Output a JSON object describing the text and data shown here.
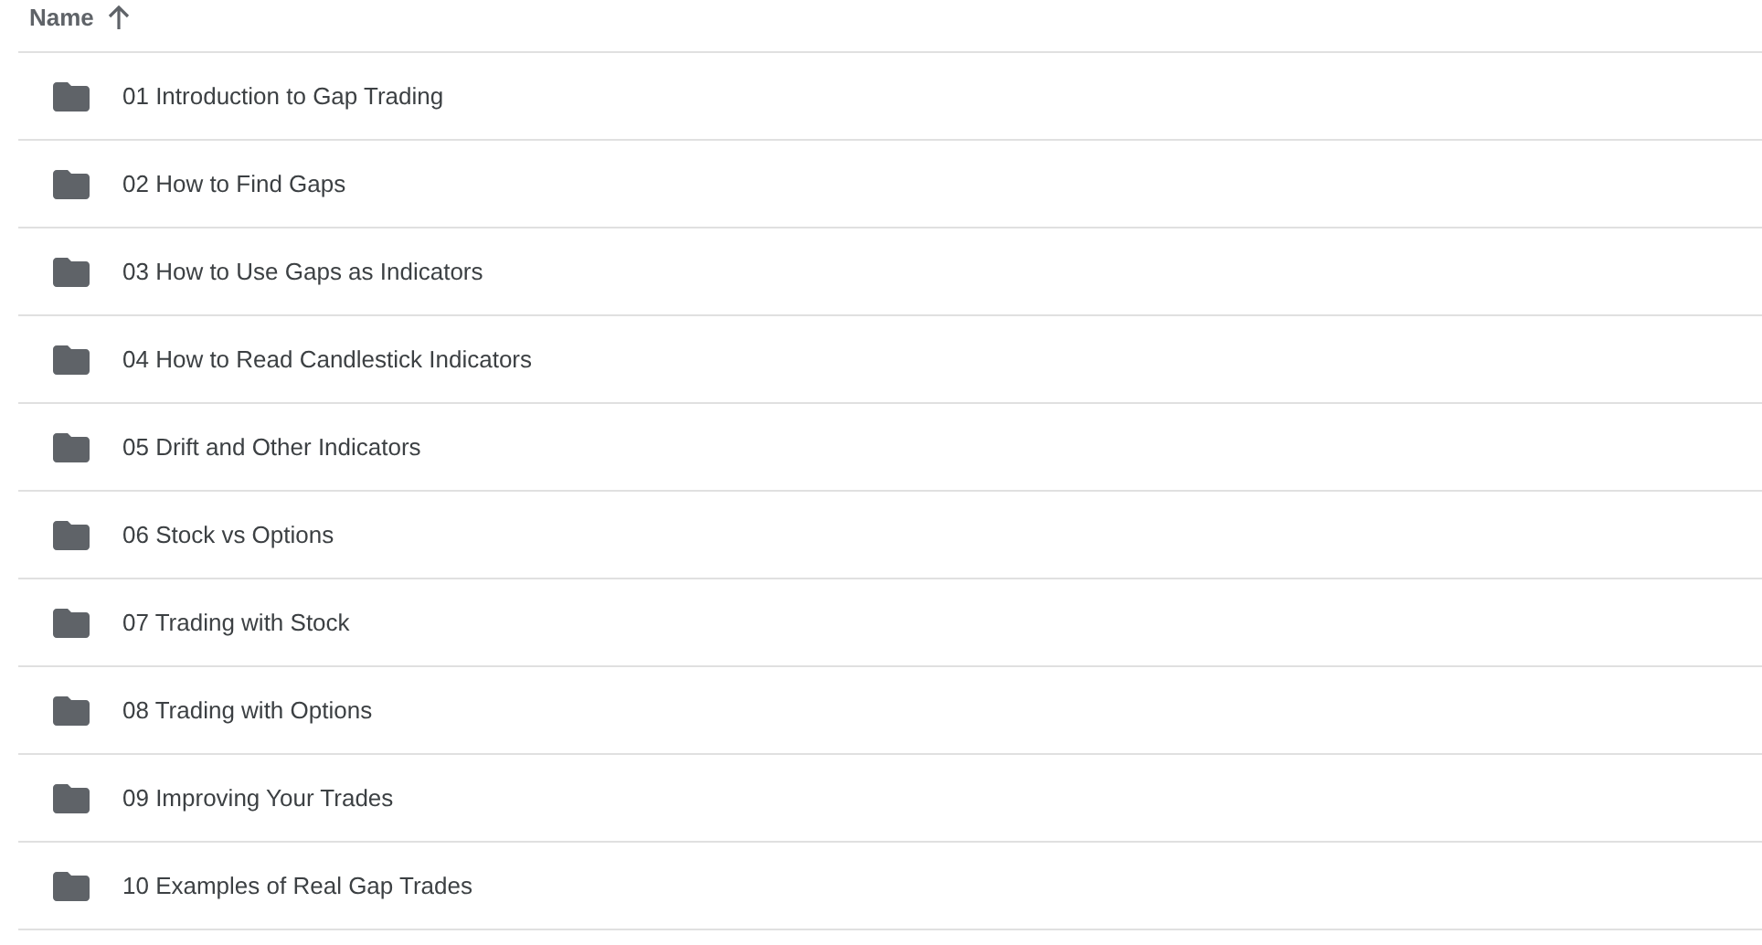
{
  "column_header": {
    "label": "Name",
    "ascending": true
  },
  "folders": [
    {
      "name": "01 Introduction to Gap Trading"
    },
    {
      "name": "02 How to Find Gaps"
    },
    {
      "name": "03 How to Use Gaps as Indicators"
    },
    {
      "name": "04 How to Read Candlestick Indicators"
    },
    {
      "name": "05 Drift and Other Indicators"
    },
    {
      "name": "06 Stock vs Options"
    },
    {
      "name": "07 Trading with Stock"
    },
    {
      "name": "08 Trading with Options"
    },
    {
      "name": "09 Improving Your Trades"
    },
    {
      "name": "10 Examples of Real Gap Trades"
    }
  ]
}
